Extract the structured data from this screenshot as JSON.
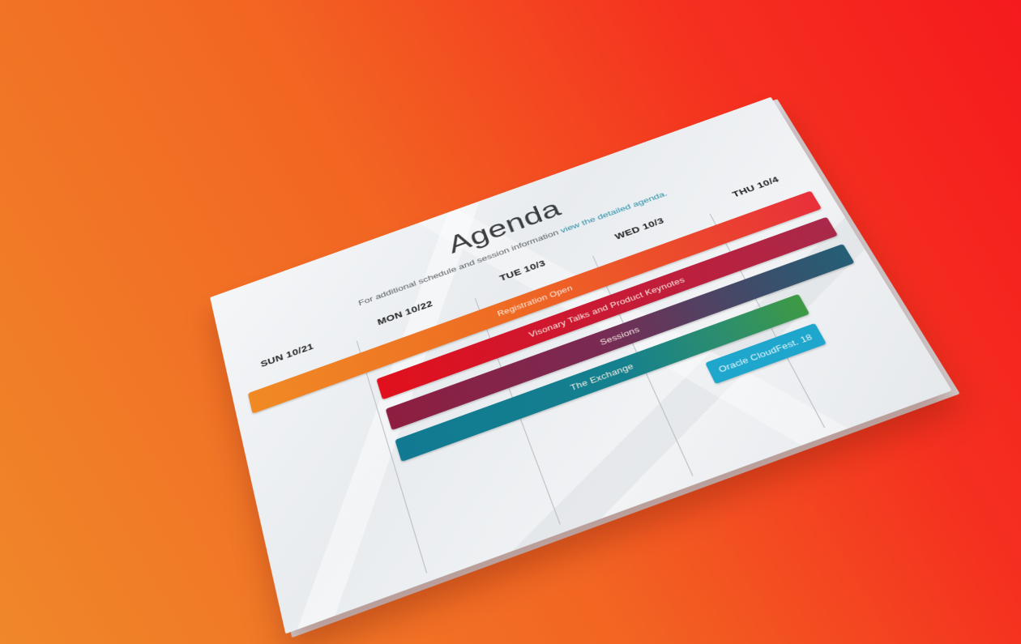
{
  "agenda": {
    "title": "Agenda",
    "subtitle_prefix": "For additional schedule and session information",
    "subtitle_link": "view the detailed agenda.",
    "days": [
      {
        "label": "SUN 10/21"
      },
      {
        "label": "MON 10/22"
      },
      {
        "label": "TUE 10/3"
      },
      {
        "label": "WED 10/3"
      },
      {
        "label": "THU 10/4"
      }
    ],
    "events": [
      {
        "label": "Registration Open"
      },
      {
        "label": "Visonary Talks and Product Keynotes"
      },
      {
        "label": "Sessions"
      },
      {
        "label": "The Exchange"
      },
      {
        "label": "Oracle CloudFest. 18"
      }
    ]
  },
  "colors": {
    "background_start": "#f0872a",
    "background_end": "#f51a1e",
    "card": "#eef0f2",
    "link": "#2a8fa8",
    "registration": "#f08a24",
    "keynotes": "#e2101c",
    "sessions": "#8e1e40",
    "exchange": "#117a92",
    "cloudfest": "#1ea6cc"
  }
}
